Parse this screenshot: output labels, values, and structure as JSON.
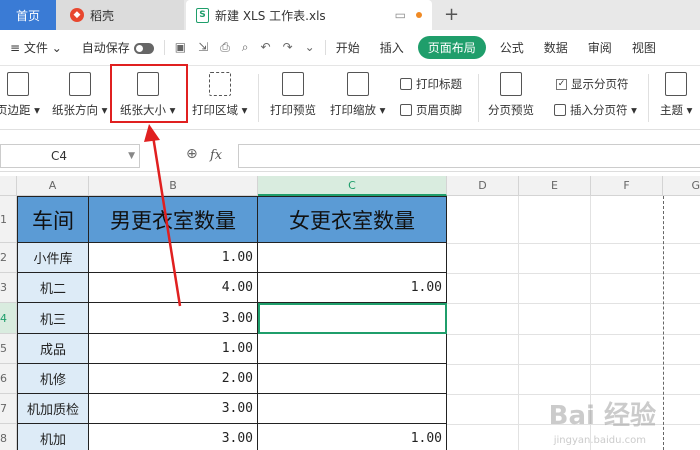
{
  "tabs": {
    "home": "首页",
    "daoke": "稻壳",
    "file": "新建 XLS 工作表.xls",
    "file_icon": "S"
  },
  "menu": {
    "file": "文件",
    "autosave": "自动保存",
    "items": [
      "开始",
      "插入",
      "页面布局",
      "公式",
      "数据",
      "审阅",
      "视图"
    ]
  },
  "ribbon": {
    "margins": "页边距",
    "orientation": "纸张方向",
    "paper_size": "纸张大小",
    "print_area": "打印区域",
    "print_preview": "打印预览",
    "print_scale": "打印缩放",
    "print_titles": "打印标题",
    "header_footer": "页眉页脚",
    "page_break_preview": "分页预览",
    "show_page_break": "显示分页符",
    "insert_page_break": "插入分页符",
    "theme": "主题"
  },
  "formula": {
    "namebox": "C4",
    "fx": "fx"
  },
  "columns": [
    "A",
    "B",
    "C",
    "D",
    "E",
    "F",
    "G"
  ],
  "rows": [
    "1",
    "2",
    "3",
    "4",
    "5",
    "6",
    "7",
    "8"
  ],
  "table": {
    "headers": [
      "车间",
      "男更衣室数量",
      "女更衣室数量"
    ],
    "rows": [
      [
        "小件库",
        "1.00",
        ""
      ],
      [
        "机二",
        "4.00",
        "1.00"
      ],
      [
        "机三",
        "3.00",
        ""
      ],
      [
        "成品",
        "1.00",
        ""
      ],
      [
        "机修",
        "2.00",
        ""
      ],
      [
        "机加质检",
        "3.00",
        ""
      ],
      [
        "机加",
        "3.00",
        "1.00"
      ]
    ]
  },
  "colors": {
    "accent": "#1f9e6b",
    "header_fill": "#5b9bd5",
    "column_a_fill": "#ddebf7",
    "annotation": "#e02020"
  },
  "watermark": {
    "main": "Bai 经验",
    "sub": "jingyan.baidu.com"
  }
}
